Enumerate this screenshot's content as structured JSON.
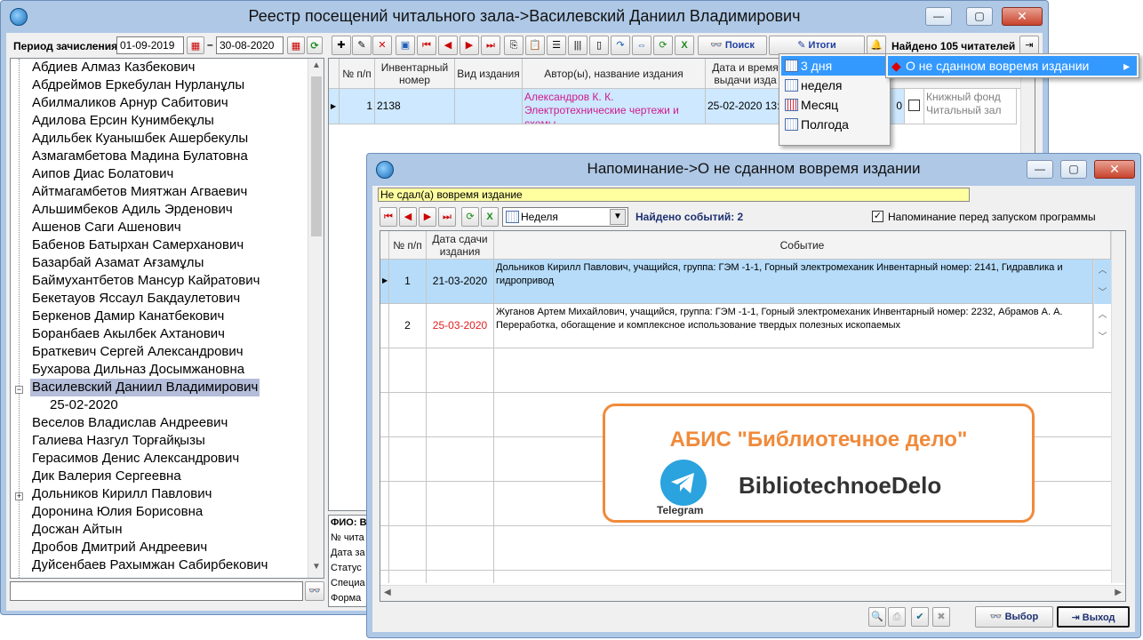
{
  "main_window": {
    "title": "Реестр посещений читального зала->Василевский Даниил Владимирович",
    "period_label": "Период зачисления",
    "date_from": "01-09-2019",
    "date_to": "30-08-2020",
    "search_label": "Поиск",
    "totals_label": "Итоги",
    "found_label": "Найдено 105 читателей",
    "minimize": "—",
    "maximize": "▢",
    "close": "✕"
  },
  "readers": [
    "Абдиев Алмаз Казбекович",
    "Абдреймов Еркебулан Нурланұлы",
    "Абилмаликов Арнур Сабитович",
    "Адилова Ерсин Кунимбекұлы",
    "Адильбек Куанышбек Ашербекулы",
    "Азмагамбетова Мадина Булатовна",
    "Аипов Диас Болатович",
    "Айтмагамбетов Миятжан Агваевич",
    "Альшимбеков Адиль Эрденович",
    "Ашенов Саги Ашенович",
    "Бабенов Батырхан Самерханович",
    "Базарбай Азамат Ағзамұлы",
    "Баймухантбетов Мансур Кайратович",
    "Бекетауов Яссаул Бакдаулетович",
    "Беркенов Дамир Канатбекович",
    "Боранбаев Акылбек Ахтанович",
    "Браткевич Сергей Александрович",
    "Бухарова Дильназ Досымжановна",
    "Василевский Даниил Владимирович",
    "25-02-2020",
    "Веселов Владислав Андреевич",
    "Галиева Назгул Торғайқызы",
    "Герасимов Денис Александрович",
    "Дик Валерия Сергеевна",
    "Дольников Кирилл Павлович",
    "Доронина Юлия Борисовна",
    "Досжан Айтын",
    "Дробов Дмитрий Андреевич",
    "Дуйсенбаев Рахымжан Сабирбекович"
  ],
  "visits_grid": {
    "headers": [
      "№ п/п",
      "Инвентарный номер",
      "Вид издания",
      "Автор(ы), название издания",
      "Дата и время выдачи изда"
    ],
    "row": {
      "num": "1",
      "inv": "2138",
      "type": "",
      "title": "Александров К. К. Электротехнические чертежи и схемы",
      "date": "25-02-2020 13:",
      "tail_num": "0",
      "fund": "Книжный фонд Читальный зал"
    }
  },
  "info_labels": [
    "ФИО: В",
    "№ чита",
    "Дата за",
    "Статус",
    "Специа",
    "Форма"
  ],
  "totals_menu": {
    "items": [
      "3 дня",
      "неделя",
      "Месяц",
      "Полгода"
    ],
    "submenu_item": "О не сданном вовремя издании"
  },
  "reminder_window": {
    "title": "Напоминание->О не сданном вовремя издании",
    "banner": "Не сдал(а) вовремя издание",
    "period_select": "Неделя",
    "found_events": "Найдено событий: 2",
    "remind_checkbox": "Напоминание перед запуском программы",
    "headers": [
      "№ п/п",
      "Дата сдачи издания",
      "Событие"
    ],
    "rows": [
      {
        "num": "1",
        "date": "21-03-2020",
        "event": "Дольников Кирилл Павлович, учащийся, группа: ГЭМ -1-1, Горный электромеханик Инвентарный номер: 2141, Гидравлика и гидропривод"
      },
      {
        "num": "2",
        "date": "25-03-2020",
        "event": "Жуганов Артем Михайлович, учащийся, группа: ГЭМ -1-1, Горный электромеханик Инвентарный номер: 2232, Абрамов А. А. Переработка, обогащение и комплексное использование твердых полезных ископаемых"
      }
    ],
    "select_button": "Выбор",
    "exit_button": "Выход",
    "minimize": "—",
    "maximize": "▢",
    "close": "✕"
  },
  "promo": {
    "headline": "АБИС \"Библиотечное дело\"",
    "telegram": "Telegram",
    "handle": "BibliotechnoeDelo"
  },
  "colors": {
    "title_bar": "#aec8e6",
    "selection": "#b4bdd9",
    "grid_selection": "#cde8ff",
    "overdue_red": "#e02020",
    "banner_yellow": "#ffffa0",
    "promo_orange": "#f08a3a",
    "menu_highlight": "#3399ff"
  }
}
